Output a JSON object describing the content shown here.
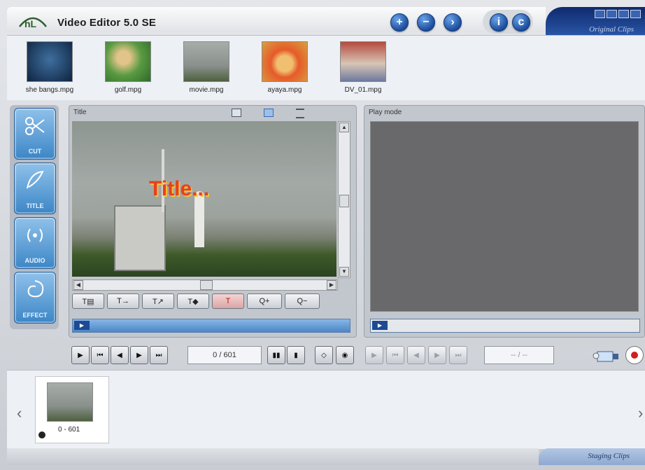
{
  "app": {
    "title": "Video Editor 5.0 SE",
    "logo_text": "hL"
  },
  "header": {
    "nav_buttons": [
      {
        "icon": "plus-icon",
        "glyph": "+"
      },
      {
        "icon": "minus-icon",
        "glyph": "−"
      },
      {
        "icon": "next-icon",
        "glyph": "›"
      }
    ],
    "pair_buttons": [
      {
        "icon": "info-icon",
        "glyph": "i"
      },
      {
        "icon": "settings-icon",
        "glyph": "c"
      }
    ],
    "original_clips_label": "Original Clips"
  },
  "clips": [
    {
      "name": "she bangs.mpg",
      "color": "#1f3f64"
    },
    {
      "name": "golf.mpg",
      "color": "#4d8a3a"
    },
    {
      "name": "movie.mpg",
      "color": "#8a9289"
    },
    {
      "name": "ayaya.mpg",
      "color": "#e0a23a"
    },
    {
      "name": "DV_01.mpg",
      "color": "#a34a3c"
    }
  ],
  "tools": [
    {
      "label": "CUT",
      "icon": "scissors-icon"
    },
    {
      "label": "TITLE",
      "icon": "title-icon"
    },
    {
      "label": "AUDIO",
      "icon": "audio-icon"
    },
    {
      "label": "EFFECT",
      "icon": "effect-icon"
    }
  ],
  "title_panel": {
    "header": "Title",
    "overlay_text": "Title...",
    "text_tools": [
      "T▤",
      "T→",
      "T↗",
      "T◆",
      "T",
      "Q+",
      "Q−"
    ],
    "vscroll_position": 0.48,
    "hscroll_position": 0.5
  },
  "play_panel": {
    "header": "Play mode"
  },
  "transport": {
    "counter": "0 / 601",
    "mode_counter": "-- / --"
  },
  "staging": {
    "clip_range": "0 - 601",
    "label": "Staging Clips"
  }
}
